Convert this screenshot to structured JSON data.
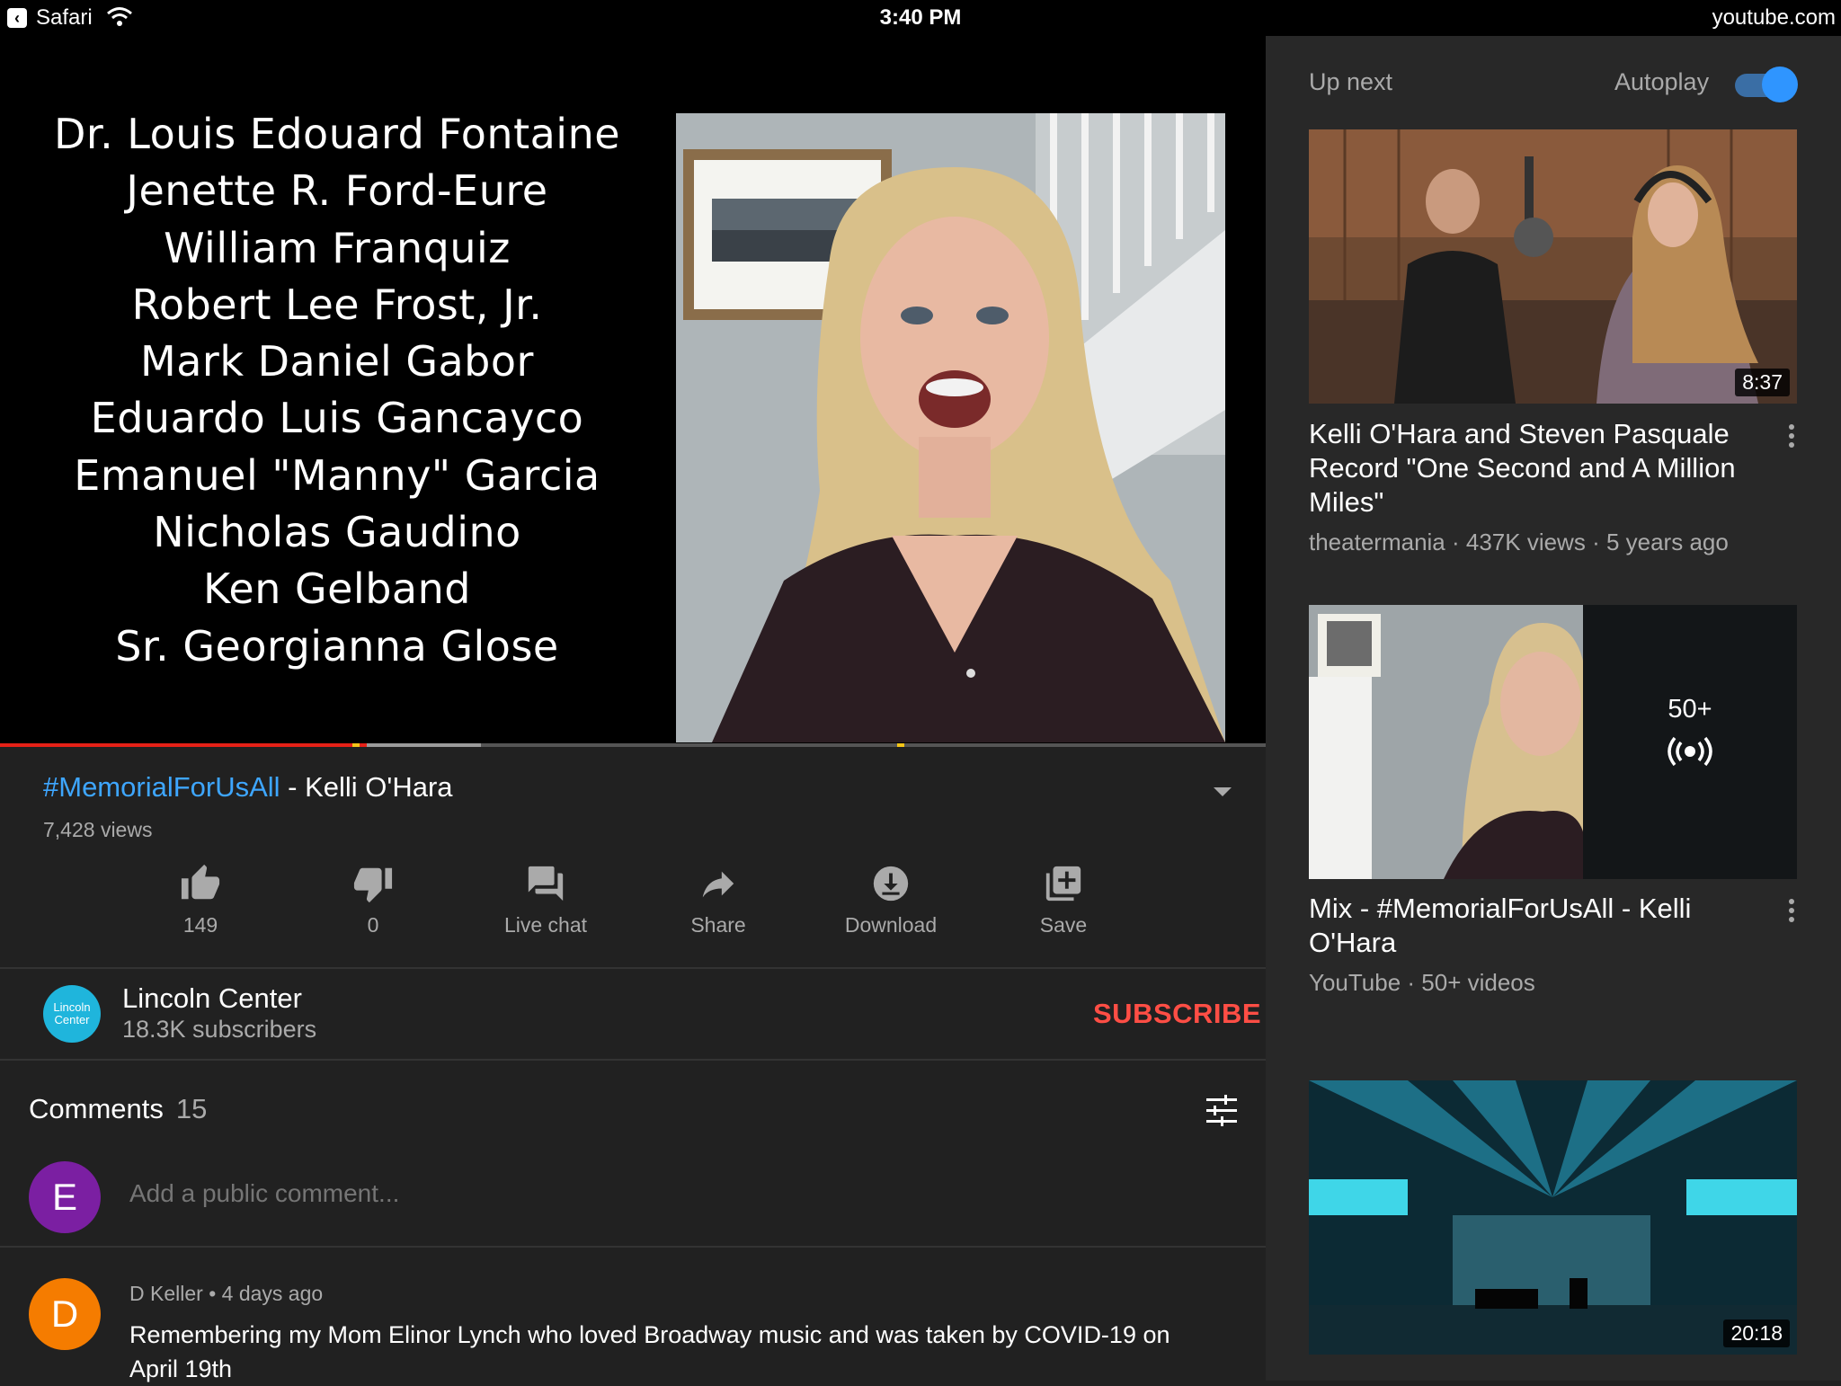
{
  "status_bar": {
    "back_app": "Safari",
    "time": "3:40 PM",
    "url": "youtube.com"
  },
  "player": {
    "names": [
      "Dr. Louis Edouard Fontaine",
      "Jenette R. Ford-Eure",
      "William Franquiz",
      "Robert Lee Frost, Jr.",
      "Mark Daniel Gabor",
      "Eduardo Luis Gancayco",
      "Emanuel \"Manny\" Garcia",
      "Nicholas Gaudino",
      "Ken Gelband",
      "Sr. Georgianna Glose"
    ],
    "progress_played": 0.29,
    "progress_buffered": 0.38
  },
  "video": {
    "hashtag": "#MemorialForUsAll",
    "title_suffix": " - Kelli O'Hara",
    "views": "7,428 views"
  },
  "actions": {
    "like_count": "149",
    "dislike_count": "0",
    "live_chat": "Live chat",
    "share": "Share",
    "download": "Download",
    "save": "Save"
  },
  "channel": {
    "name": "Lincoln Center",
    "avatar_text": "Lincoln Center",
    "subscribers": "18.3K subscribers",
    "subscribe_label": "SUBSCRIBE"
  },
  "comments": {
    "heading": "Comments",
    "count": "15",
    "my_avatar_letter": "E",
    "input_placeholder": "Add a public comment...",
    "items": [
      {
        "avatar_letter": "D",
        "author": "D Keller",
        "age": "4 days ago",
        "text": "Remembering my Mom Elinor Lynch who loved Broadway music and was taken by COVID-19 on April 19th"
      }
    ]
  },
  "up_next": {
    "label": "Up next",
    "autoplay_label": "Autoplay",
    "autoplay_on": true,
    "videos": [
      {
        "title": "Kelli O'Hara and Steven Pasquale Record \"One Second and A Million Miles\"",
        "channel": "theatermania",
        "views": "437K views",
        "age": "5 years ago",
        "duration": "8:37"
      },
      {
        "title": "Mix - #MemorialForUsAll - Kelli O'Hara",
        "channel": "YouTube",
        "videos": "50+ videos",
        "playlist_count": "50+"
      },
      {
        "duration": "20:18"
      }
    ]
  },
  "colors": {
    "background": "#212121",
    "sidebar": "#282828",
    "link": "#3ea6ff",
    "subscribe": "#ff4e45",
    "progress_played": "#e62117"
  }
}
